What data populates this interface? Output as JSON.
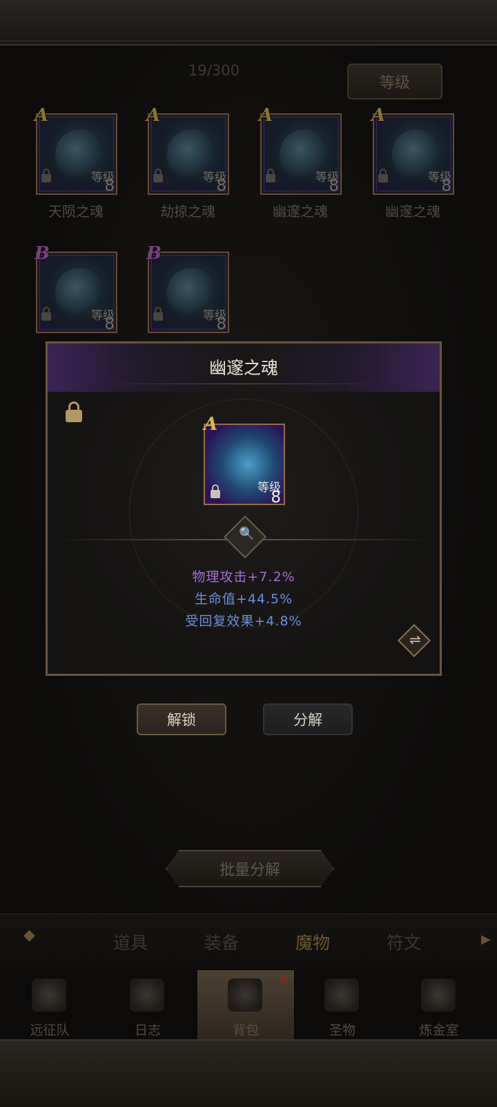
{
  "header": {
    "count": "19/300",
    "sort_label": "等级"
  },
  "inventory": [
    {
      "grade": "A",
      "level_label": "等级",
      "level": "8",
      "name": "天陨之魂"
    },
    {
      "grade": "A",
      "level_label": "等级",
      "level": "8",
      "name": "劫掠之魂"
    },
    {
      "grade": "A",
      "level_label": "等级",
      "level": "8",
      "name": "幽邃之魂"
    },
    {
      "grade": "A",
      "level_label": "等级",
      "level": "8",
      "name": "幽邃之魂"
    },
    {
      "grade": "B",
      "level_label": "等级",
      "level": "8",
      "name": ""
    },
    {
      "grade": "B",
      "level_label": "等级",
      "level": "8",
      "name": ""
    }
  ],
  "detail": {
    "title": "幽邃之魂",
    "grade": "A",
    "level_label": "等级",
    "level": "8",
    "search_icon": "🔍",
    "swap_icon": "⇌",
    "stats": [
      "物理攻击+7.2%",
      "生命值+44.5%",
      "受回复效果+4.8%"
    ]
  },
  "actions": {
    "unlock": "解锁",
    "decompose": "分解",
    "batch_decompose": "批量分解"
  },
  "tabs": {
    "back_icon": "◆",
    "items": [
      "道具",
      "装备",
      "魔物",
      "符文"
    ],
    "active": "魔物",
    "more": "▶"
  },
  "bottom_nav": [
    "远征队",
    "日志",
    "背包",
    "圣物",
    "炼金室"
  ],
  "colors": {
    "accent_gold": "#e4b93a",
    "grade_b": "#7a3e86",
    "stat_purple": "#a66bdc",
    "stat_blue": "#6a8fe0"
  }
}
